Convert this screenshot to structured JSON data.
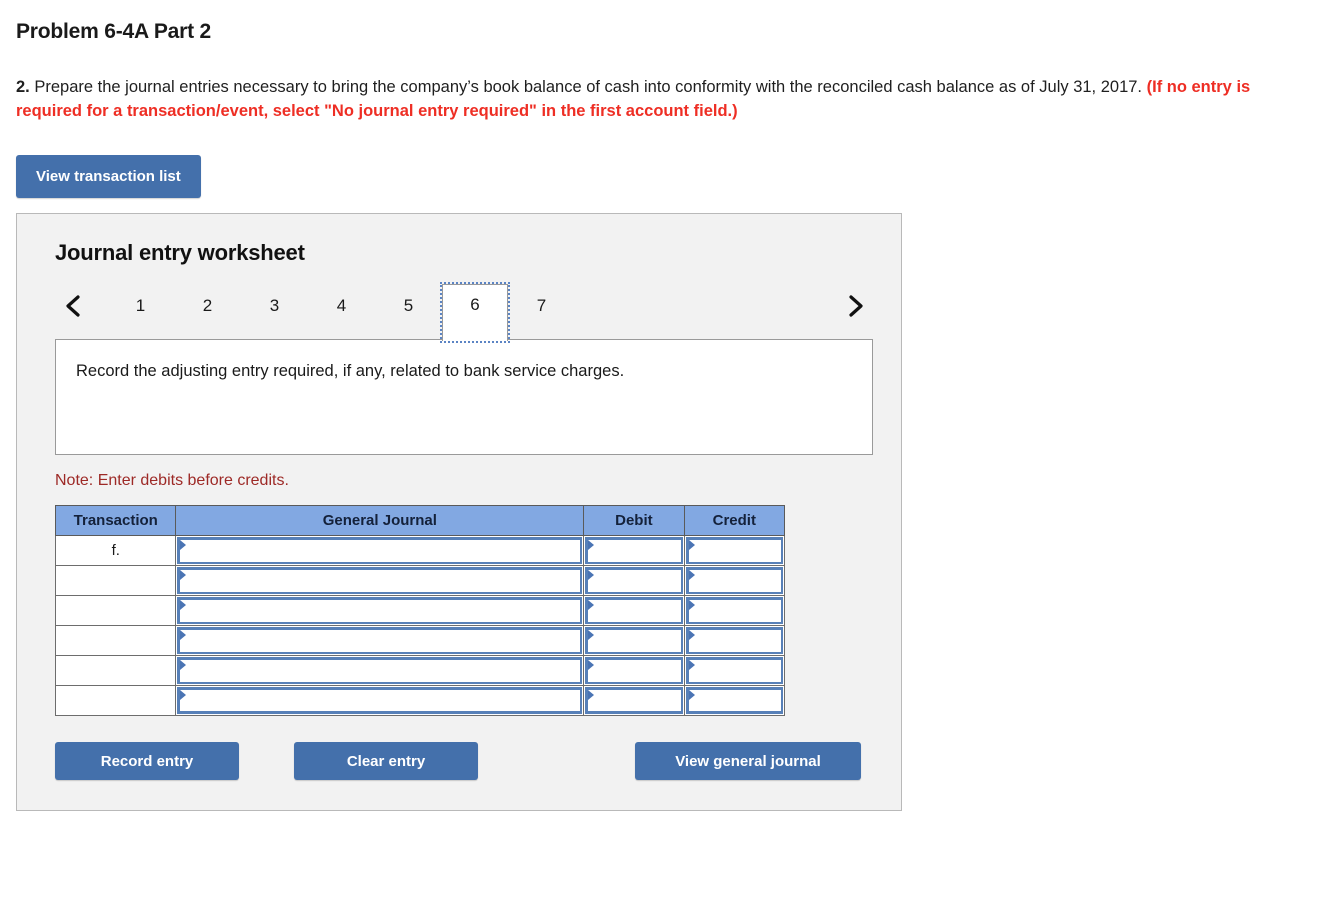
{
  "page": {
    "title": "Problem 6-4A Part 2",
    "instruction": {
      "number": "2.",
      "text": " Prepare the journal entries necessary to bring the company’s book balance of cash into conformity with the reconciled cash balance as of July 31, 2017. ",
      "red_note": "(If no entry is required for a transaction/event, select \"No journal entry required\" in the first account field.)"
    },
    "view_transaction_list_label": "View transaction list"
  },
  "worksheet": {
    "title": "Journal entry worksheet",
    "prev_arrow_icon": "chevron-left-icon",
    "next_arrow_icon": "chevron-right-icon",
    "tabs": [
      {
        "label": "1",
        "active": false
      },
      {
        "label": "2",
        "active": false
      },
      {
        "label": "3",
        "active": false
      },
      {
        "label": "4",
        "active": false
      },
      {
        "label": "5",
        "active": false
      },
      {
        "label": "6",
        "active": true
      },
      {
        "label": "7",
        "active": false
      }
    ],
    "active_tab": "6",
    "description": "Record the adjusting entry required, if any, related to bank service charges.",
    "note": "Note: Enter debits before credits.",
    "note_color": "#9d2926",
    "table": {
      "headers": [
        "Transaction",
        "General Journal",
        "Debit",
        "Credit"
      ],
      "header_bg": "#82a8e2",
      "rows": [
        {
          "transaction": "f.",
          "general_journal": "",
          "debit": "",
          "credit": ""
        },
        {
          "transaction": "",
          "general_journal": "",
          "debit": "",
          "credit": ""
        },
        {
          "transaction": "",
          "general_journal": "",
          "debit": "",
          "credit": ""
        },
        {
          "transaction": "",
          "general_journal": "",
          "debit": "",
          "credit": ""
        },
        {
          "transaction": "",
          "general_journal": "",
          "debit": "",
          "credit": ""
        },
        {
          "transaction": "",
          "general_journal": "",
          "debit": "",
          "credit": ""
        }
      ]
    },
    "buttons": {
      "record_entry": "Record entry",
      "clear_entry": "Clear entry",
      "view_general_journal": "View general journal",
      "color": "#4470ab"
    }
  }
}
